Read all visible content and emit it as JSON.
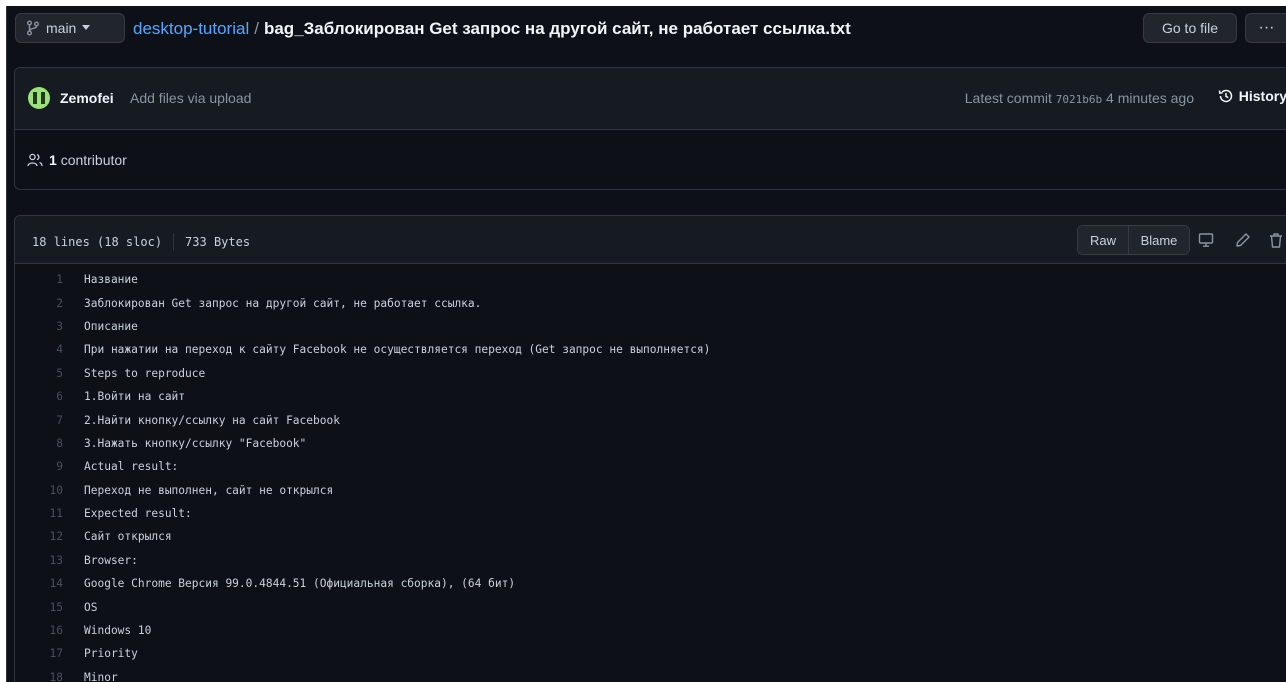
{
  "header": {
    "branch": "main",
    "repo": "desktop-tutorial",
    "separator": "/",
    "filename": "bag_Заблокирован Get запрос на другой сайт, не работает ссылка.txt",
    "goto_label": "Go to file",
    "more_label": "···"
  },
  "commit": {
    "author": "Zemofei",
    "message": "Add files via upload",
    "latest_prefix": "Latest commit",
    "sha": "7021b6b",
    "time": "4 minutes ago",
    "history_label": "History"
  },
  "contributors": {
    "count": "1",
    "label": "contributor"
  },
  "file": {
    "lines_info": "18 lines (18 sloc)",
    "size": "733 Bytes",
    "raw_label": "Raw",
    "blame_label": "Blame"
  },
  "code_lines": [
    "Название",
    "Заблокирован Get запрос на другой сайт, не работает ссылка.",
    "Описание",
    "При нажатии на переход к сайту Facebook не осуществляется переход (Get запрос не выполняется)",
    "Steps to reproduce",
    "1.Войти на сайт",
    "2.Найти кнопку/ссылку на сайт Facebook",
    "3.Нажать кнопку/ссылку \"Facebook\"",
    "Actual result:",
    "Переход не выполнен, сайт не открылся",
    "Expected result:",
    "Сайт открылся",
    "Browser:",
    "Google Chrome Версия 99.0.4844.51 (Официальная сборка), (64 бит)",
    "OS",
    "Windows 10",
    "Priority",
    "Minor"
  ],
  "colors": {
    "background": "#0d1117",
    "panel": "#161b22",
    "link": "#58a6ff",
    "muted": "#8b949e"
  }
}
